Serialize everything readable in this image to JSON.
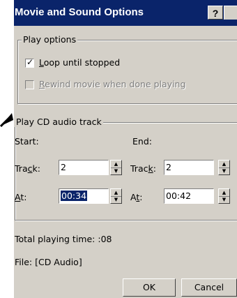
{
  "dialog": {
    "title": "Movie and Sound Options",
    "help_label": "?"
  },
  "play_options": {
    "legend": "Play options",
    "loop": {
      "pre": "",
      "key": "L",
      "post": "oop until stopped",
      "checked": true
    },
    "rewind": {
      "pre": "",
      "key": "R",
      "post": "ewind movie when done playing",
      "checked": false,
      "disabled": true
    }
  },
  "cd_track": {
    "legend": "Play CD audio track",
    "start_label": "Start:",
    "end_label": "End:",
    "start_track": {
      "label_pre": "Tra",
      "label_key": "c",
      "label_post": "k:",
      "value": "2"
    },
    "start_at": {
      "label_pre": "",
      "label_key": "A",
      "label_post": "t:",
      "value": "00:34"
    },
    "end_track": {
      "label_pre": "Trac",
      "label_key": "k",
      "label_post": ":",
      "value": "2"
    },
    "end_at": {
      "label_pre": "A",
      "label_key": "t",
      "label_post": ":",
      "value": "00:42"
    }
  },
  "info": {
    "total_time": "Total playing time:  :08",
    "file": "File:  [CD Audio]"
  },
  "buttons": {
    "ok": "OK",
    "cancel": "Cancel"
  },
  "icons": {
    "pointer": "arrow-pointer-icon",
    "help": "help-icon",
    "check": "checkmark-icon",
    "spin_up": "triangle-up-icon",
    "spin_down": "triangle-down-icon"
  }
}
